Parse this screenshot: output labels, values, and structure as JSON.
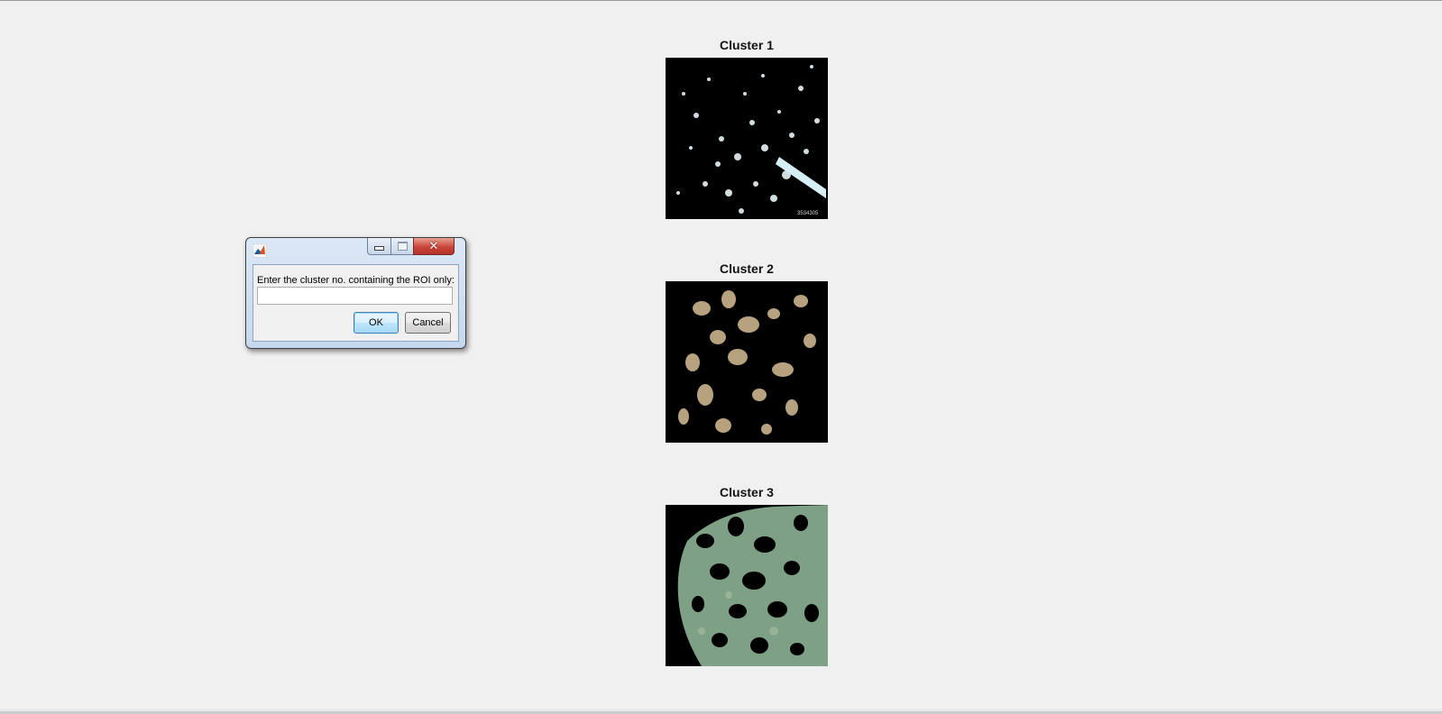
{
  "figure": {
    "axes": [
      {
        "title": "Cluster 1",
        "image": "cluster-1-segmented-leaf"
      },
      {
        "title": "Cluster 2",
        "image": "cluster-2-segmented-leaf"
      },
      {
        "title": "Cluster 3",
        "image": "cluster-3-segmented-leaf"
      }
    ],
    "watermark": "3534305"
  },
  "dialog": {
    "title": "",
    "icon": "matlab-icon",
    "prompt": "Enter the cluster no. containing the ROI only:",
    "input_value": "",
    "ok_label": "OK",
    "cancel_label": "Cancel",
    "window_buttons": [
      "minimize-icon",
      "maximize-icon",
      "close-icon"
    ]
  },
  "colors": {
    "background": "#f0f0f0",
    "cluster_background": "#000000",
    "cluster1_speck": "#e8f4f8",
    "cluster2_blob": "#cbb48e",
    "cluster3_leaf": "#7ea084",
    "close_button": "#c9463a"
  }
}
